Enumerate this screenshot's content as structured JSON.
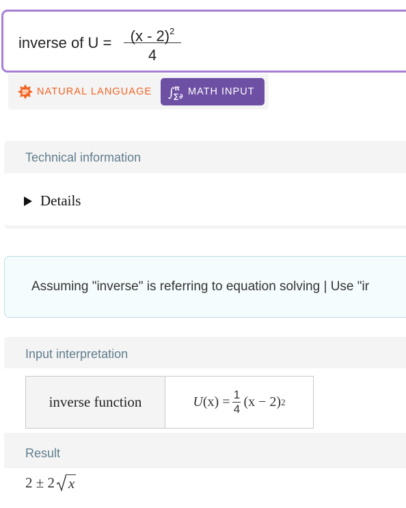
{
  "query": {
    "prefix": "inverse of U =",
    "numerator": "(x - 2)",
    "exponent": "2",
    "denominator": "4"
  },
  "mode_toggle": {
    "natural_label": "NATURAL LANGUAGE",
    "natural_icon": "natural-language-icon",
    "natural_color": "#f26322",
    "math_label": "MATH INPUT",
    "math_icon": "math-symbols-icon",
    "math_color": "#6d4fa3"
  },
  "technical_pod": {
    "title": "Technical information",
    "details_label": "Details"
  },
  "assumption": {
    "text": "Assuming \"inverse\" is referring to equation solving",
    "separator": "|",
    "alt_link": "Use \"ir"
  },
  "interpretation_pod": {
    "title": "Input interpretation",
    "label": "inverse function",
    "formula": {
      "lhs_func": "U",
      "lhs_var": "(x)",
      "equals": "=",
      "frac_num": "1",
      "frac_den": "4",
      "factor": "(x − 2)",
      "exponent": "2"
    }
  },
  "result_pod": {
    "title": "Result",
    "formula": {
      "prefix": "2 ± 2",
      "radicand": "x"
    }
  },
  "colors": {
    "pod_title": "#607d8b",
    "query_border": "#a57fd1",
    "assumption_border": "#bcdbe3"
  }
}
